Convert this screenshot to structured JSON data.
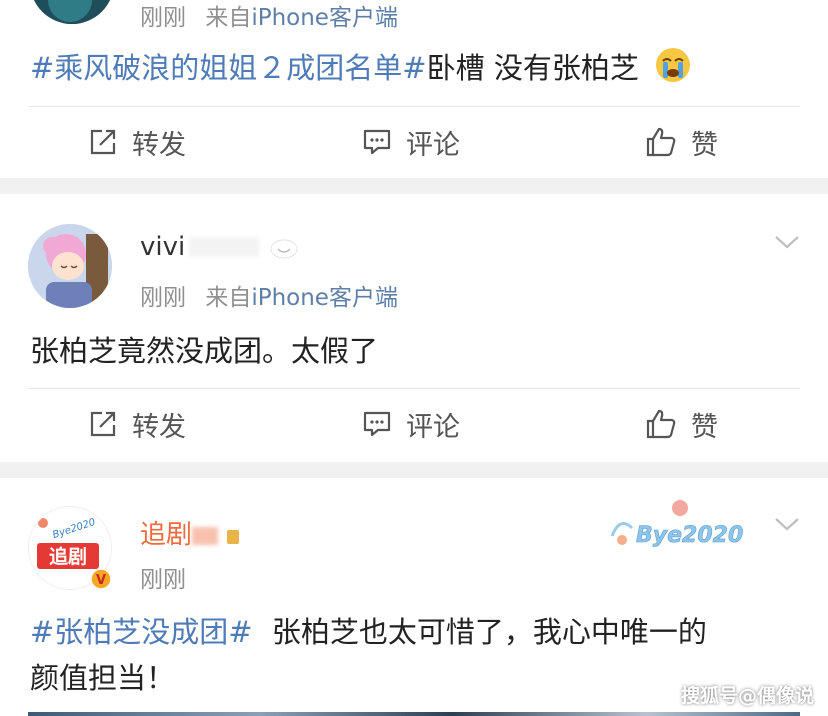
{
  "posts": [
    {
      "meta_time": "刚刚",
      "meta_from": "来自",
      "meta_device": "iPhone",
      "meta_client": "客户端",
      "text_tag": "#乘风破浪的姐姐２成团名单#",
      "text_body": "卧槽 没有张柏芝",
      "emoji": "crying-face-icon",
      "actions": {
        "repost": "转发",
        "comment": "评论",
        "like": "赞"
      }
    },
    {
      "username": "vivi",
      "meta_time": "刚刚",
      "meta_from": "来自",
      "meta_device": "iPhone",
      "meta_client": "客户端",
      "text_body": "张柏芝竟然没成团。太假了",
      "actions": {
        "repost": "转发",
        "comment": "评论",
        "like": "赞"
      }
    },
    {
      "username": "追剧",
      "avatar_badge": "V",
      "avatar_logo_text": "追剧",
      "avatar_logo_small": "Bye2020",
      "meta_time": "刚刚",
      "card_sticker": "Bye2020",
      "text_tag": "#张柏芝没成团#",
      "text_body_line1": "张柏芝也太可惜了，我心中唯一的",
      "text_body_line2": "颜值担当！"
    }
  ],
  "watermark": "搜狐号@偶像说",
  "colors": {
    "accent_link": "#4f7cb8",
    "device_link": "#5e7fa8",
    "meta_gray": "#909090",
    "separator": "#f1f1f1",
    "verified": "#f5a623"
  }
}
